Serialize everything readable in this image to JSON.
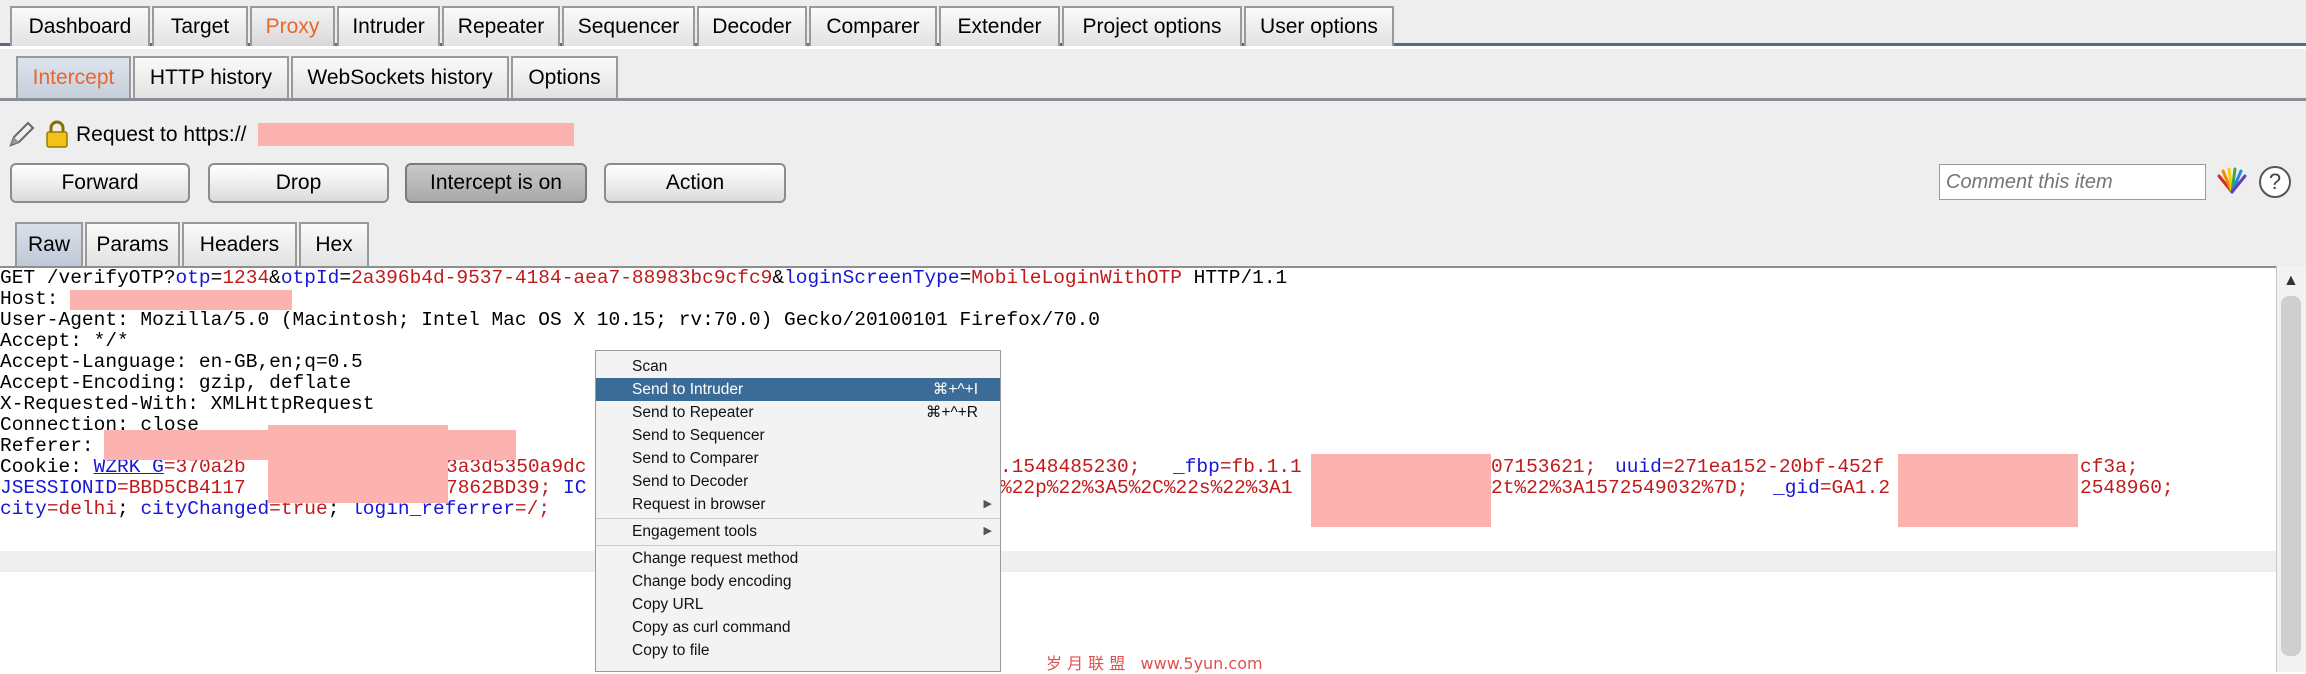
{
  "top_tabs": [
    "Dashboard",
    "Target",
    "Proxy",
    "Intruder",
    "Repeater",
    "Sequencer",
    "Decoder",
    "Comparer",
    "Extender",
    "Project options",
    "User options"
  ],
  "sub_tabs": [
    "Intercept",
    "HTTP history",
    "WebSockets history",
    "Options"
  ],
  "request_label": "Request to https://",
  "buttons": {
    "forward": "Forward",
    "drop": "Drop",
    "intercept": "Intercept is on",
    "action": "Action"
  },
  "comment_placeholder": "Comment this item",
  "help_symbol": "?",
  "content_tabs": [
    "Raw",
    "Params",
    "Headers",
    "Hex"
  ],
  "request": {
    "l1": {
      "pre": "GET /verifyOTP?",
      "p1": "otp",
      "eq1": "=",
      "v1": "1234",
      "amp1": "&",
      "p2": "otpId",
      "eq2": "=",
      "v2": "2a396b4d-9537-4184-aea7-88983bc9cfc9",
      "amp2": "&",
      "p3": "loginScreenType",
      "eq3": "=",
      "v3": "MobileLoginWithOTP",
      "post": " HTTP/1.1"
    },
    "l2": "Host: ",
    "l3": "User-Agent: Mozilla/5.0 (Macintosh; Intel Mac OS X 10.15; rv:70.0) Gecko/20100101 Firefox/70.0",
    "l4": "Accept: */*",
    "l5": "Accept-Language: en-GB,en;q=0.5",
    "l6": "Accept-Encoding: gzip, deflate",
    "l7": "X-Requested-With: XMLHttpRequest",
    "l8": "Connection: close",
    "l9": "Referer: ",
    "cookie": {
      "label": "Cookie: ",
      "k1": "WZRK_G",
      "v1a": "=370a2b",
      "v1b": "3a3d5350a9dc",
      "v2": ".1548485230; ",
      "k3": "_fbp",
      "v3a": "=fb.1.1",
      "v3b": "07153621; ",
      "k4": "uuid",
      "v4a": "=271ea152-20bf-452f",
      "v4b": "cf3a;",
      "k5": "JSESSIONID",
      "v5a": "=BBD5CB4117",
      "v5b": "7862BD39; ",
      "k6": "IC",
      "v6": "%22p%22%3A5%2C%22s%22%3A1",
      "v7": "2t%22%3A1572549032%7D; ",
      "k8": "_gid",
      "v8a": "=GA1.2",
      "v8b": "2548960;",
      "k9": "city",
      "v9": "=delhi",
      "s9": "; ",
      "k10": "cityChanged",
      "v10": "=true",
      "s10": "; ",
      "k11": "login_referrer",
      "v11": "=/;"
    }
  },
  "context_menu": [
    {
      "label": "Scan"
    },
    {
      "label": "Send to Intruder",
      "shortcut": "⌘+^+I",
      "highlighted": true
    },
    {
      "label": "Send to Repeater",
      "shortcut": "⌘+^+R"
    },
    {
      "label": "Send to Sequencer"
    },
    {
      "label": "Send to Comparer"
    },
    {
      "label": "Send to Decoder"
    },
    {
      "label": "Request in browser",
      "submenu": true
    },
    {
      "label": "Engagement tools",
      "submenu": true
    },
    {
      "label": "Change request method"
    },
    {
      "label": "Change body encoding"
    },
    {
      "label": "Copy URL"
    },
    {
      "label": "Copy as curl command"
    },
    {
      "label": "Copy to file"
    }
  ],
  "watermark": "岁 月 联 盟   www.5yun.com",
  "colors": {
    "accent": "#e8672d",
    "menu_highlight": "#3b6b97",
    "param_name": "#1717d6",
    "param_value": "#c11a1a",
    "redaction": "#fcb3b0"
  },
  "icons": [
    "pencil-icon",
    "lock-icon",
    "color-wheel-icon",
    "help-icon",
    "scroll-up-arrow-icon"
  ]
}
